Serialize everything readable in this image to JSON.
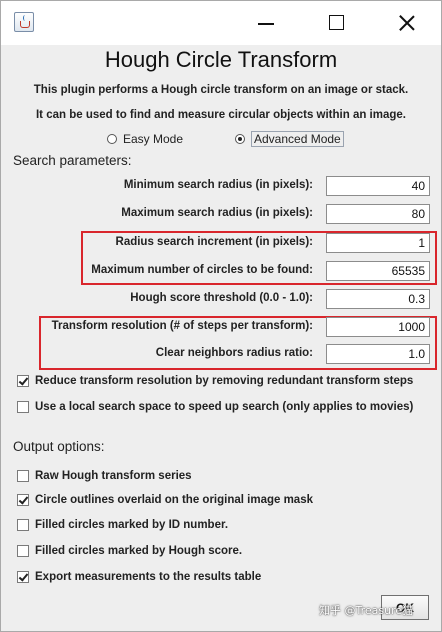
{
  "window": {
    "title": "Hough Circle Transform"
  },
  "description": {
    "line1": "This plugin performs a Hough circle transform on an image or stack.",
    "line2": "It can be used to find and measure circular objects within an image."
  },
  "modes": [
    {
      "label": "Easy Mode",
      "selected": false
    },
    {
      "label": "Advanced Mode",
      "selected": true
    }
  ],
  "search": {
    "heading": "Search parameters:",
    "fields": [
      {
        "label": "Minimum search radius (in pixels):",
        "value": "40"
      },
      {
        "label": "Maximum search radius (in pixels):",
        "value": "80"
      },
      {
        "label": "Radius search increment (in pixels):",
        "value": "1"
      },
      {
        "label": "Maximum number of circles to be found:",
        "value": "65535"
      },
      {
        "label": "Hough score threshold (0.0 - 1.0):",
        "value": "0.3"
      },
      {
        "label": "Transform resolution (# of steps per transform):",
        "value": "1000"
      },
      {
        "label": "Clear neighbors radius ratio:",
        "value": "1.0"
      }
    ],
    "checks": [
      {
        "label": "Reduce transform resolution by removing redundant transform steps",
        "checked": true
      },
      {
        "label": "Use a local search space to speed up search (only applies to movies)",
        "checked": false
      }
    ]
  },
  "output": {
    "heading": "Output options:",
    "checks": [
      {
        "label": "Raw Hough transform series",
        "checked": false
      },
      {
        "label": "Circle outlines overlaid on the original image mask",
        "checked": true
      },
      {
        "label": "Filled circles marked by ID number.",
        "checked": false
      },
      {
        "label": "Filled circles marked by Hough score.",
        "checked": false
      },
      {
        "label": "Export measurements to the results table",
        "checked": true
      }
    ]
  },
  "buttons": {
    "ok": "OK"
  },
  "watermark": "知乎 @Treasure猫",
  "colors": {
    "highlight": "#d9262c",
    "dialog_bg": "#eeeeee"
  }
}
